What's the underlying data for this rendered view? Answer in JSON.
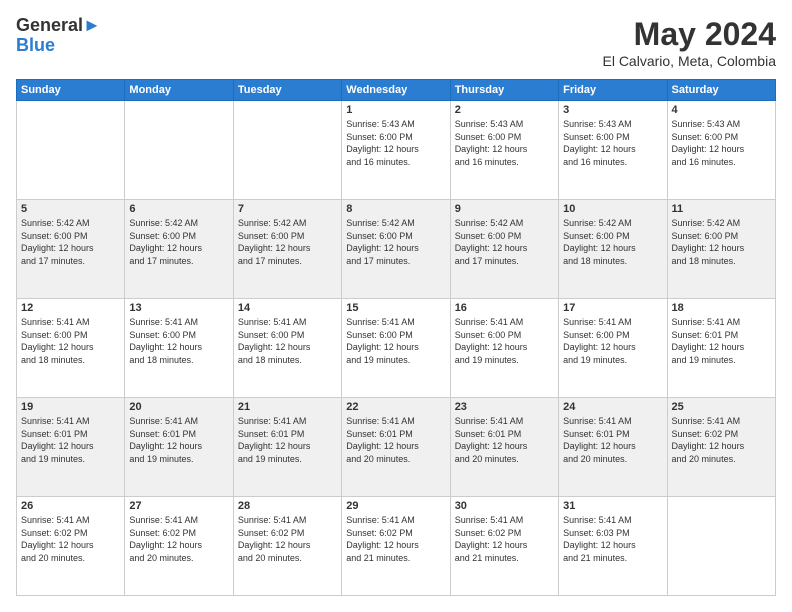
{
  "header": {
    "logo_line1": "General",
    "logo_line2": "Blue",
    "title": "May 2024",
    "subtitle": "El Calvario, Meta, Colombia"
  },
  "days_of_week": [
    "Sunday",
    "Monday",
    "Tuesday",
    "Wednesday",
    "Thursday",
    "Friday",
    "Saturday"
  ],
  "weeks": [
    [
      {
        "day": "",
        "info": ""
      },
      {
        "day": "",
        "info": ""
      },
      {
        "day": "",
        "info": ""
      },
      {
        "day": "1",
        "info": "Sunrise: 5:43 AM\nSunset: 6:00 PM\nDaylight: 12 hours\nand 16 minutes."
      },
      {
        "day": "2",
        "info": "Sunrise: 5:43 AM\nSunset: 6:00 PM\nDaylight: 12 hours\nand 16 minutes."
      },
      {
        "day": "3",
        "info": "Sunrise: 5:43 AM\nSunset: 6:00 PM\nDaylight: 12 hours\nand 16 minutes."
      },
      {
        "day": "4",
        "info": "Sunrise: 5:43 AM\nSunset: 6:00 PM\nDaylight: 12 hours\nand 16 minutes."
      }
    ],
    [
      {
        "day": "5",
        "info": "Sunrise: 5:42 AM\nSunset: 6:00 PM\nDaylight: 12 hours\nand 17 minutes."
      },
      {
        "day": "6",
        "info": "Sunrise: 5:42 AM\nSunset: 6:00 PM\nDaylight: 12 hours\nand 17 minutes."
      },
      {
        "day": "7",
        "info": "Sunrise: 5:42 AM\nSunset: 6:00 PM\nDaylight: 12 hours\nand 17 minutes."
      },
      {
        "day": "8",
        "info": "Sunrise: 5:42 AM\nSunset: 6:00 PM\nDaylight: 12 hours\nand 17 minutes."
      },
      {
        "day": "9",
        "info": "Sunrise: 5:42 AM\nSunset: 6:00 PM\nDaylight: 12 hours\nand 17 minutes."
      },
      {
        "day": "10",
        "info": "Sunrise: 5:42 AM\nSunset: 6:00 PM\nDaylight: 12 hours\nand 18 minutes."
      },
      {
        "day": "11",
        "info": "Sunrise: 5:42 AM\nSunset: 6:00 PM\nDaylight: 12 hours\nand 18 minutes."
      }
    ],
    [
      {
        "day": "12",
        "info": "Sunrise: 5:41 AM\nSunset: 6:00 PM\nDaylight: 12 hours\nand 18 minutes."
      },
      {
        "day": "13",
        "info": "Sunrise: 5:41 AM\nSunset: 6:00 PM\nDaylight: 12 hours\nand 18 minutes."
      },
      {
        "day": "14",
        "info": "Sunrise: 5:41 AM\nSunset: 6:00 PM\nDaylight: 12 hours\nand 18 minutes."
      },
      {
        "day": "15",
        "info": "Sunrise: 5:41 AM\nSunset: 6:00 PM\nDaylight: 12 hours\nand 19 minutes."
      },
      {
        "day": "16",
        "info": "Sunrise: 5:41 AM\nSunset: 6:00 PM\nDaylight: 12 hours\nand 19 minutes."
      },
      {
        "day": "17",
        "info": "Sunrise: 5:41 AM\nSunset: 6:00 PM\nDaylight: 12 hours\nand 19 minutes."
      },
      {
        "day": "18",
        "info": "Sunrise: 5:41 AM\nSunset: 6:01 PM\nDaylight: 12 hours\nand 19 minutes."
      }
    ],
    [
      {
        "day": "19",
        "info": "Sunrise: 5:41 AM\nSunset: 6:01 PM\nDaylight: 12 hours\nand 19 minutes."
      },
      {
        "day": "20",
        "info": "Sunrise: 5:41 AM\nSunset: 6:01 PM\nDaylight: 12 hours\nand 19 minutes."
      },
      {
        "day": "21",
        "info": "Sunrise: 5:41 AM\nSunset: 6:01 PM\nDaylight: 12 hours\nand 19 minutes."
      },
      {
        "day": "22",
        "info": "Sunrise: 5:41 AM\nSunset: 6:01 PM\nDaylight: 12 hours\nand 20 minutes."
      },
      {
        "day": "23",
        "info": "Sunrise: 5:41 AM\nSunset: 6:01 PM\nDaylight: 12 hours\nand 20 minutes."
      },
      {
        "day": "24",
        "info": "Sunrise: 5:41 AM\nSunset: 6:01 PM\nDaylight: 12 hours\nand 20 minutes."
      },
      {
        "day": "25",
        "info": "Sunrise: 5:41 AM\nSunset: 6:02 PM\nDaylight: 12 hours\nand 20 minutes."
      }
    ],
    [
      {
        "day": "26",
        "info": "Sunrise: 5:41 AM\nSunset: 6:02 PM\nDaylight: 12 hours\nand 20 minutes."
      },
      {
        "day": "27",
        "info": "Sunrise: 5:41 AM\nSunset: 6:02 PM\nDaylight: 12 hours\nand 20 minutes."
      },
      {
        "day": "28",
        "info": "Sunrise: 5:41 AM\nSunset: 6:02 PM\nDaylight: 12 hours\nand 20 minutes."
      },
      {
        "day": "29",
        "info": "Sunrise: 5:41 AM\nSunset: 6:02 PM\nDaylight: 12 hours\nand 21 minutes."
      },
      {
        "day": "30",
        "info": "Sunrise: 5:41 AM\nSunset: 6:02 PM\nDaylight: 12 hours\nand 21 minutes."
      },
      {
        "day": "31",
        "info": "Sunrise: 5:41 AM\nSunset: 6:03 PM\nDaylight: 12 hours\nand 21 minutes."
      },
      {
        "day": "",
        "info": ""
      }
    ]
  ]
}
